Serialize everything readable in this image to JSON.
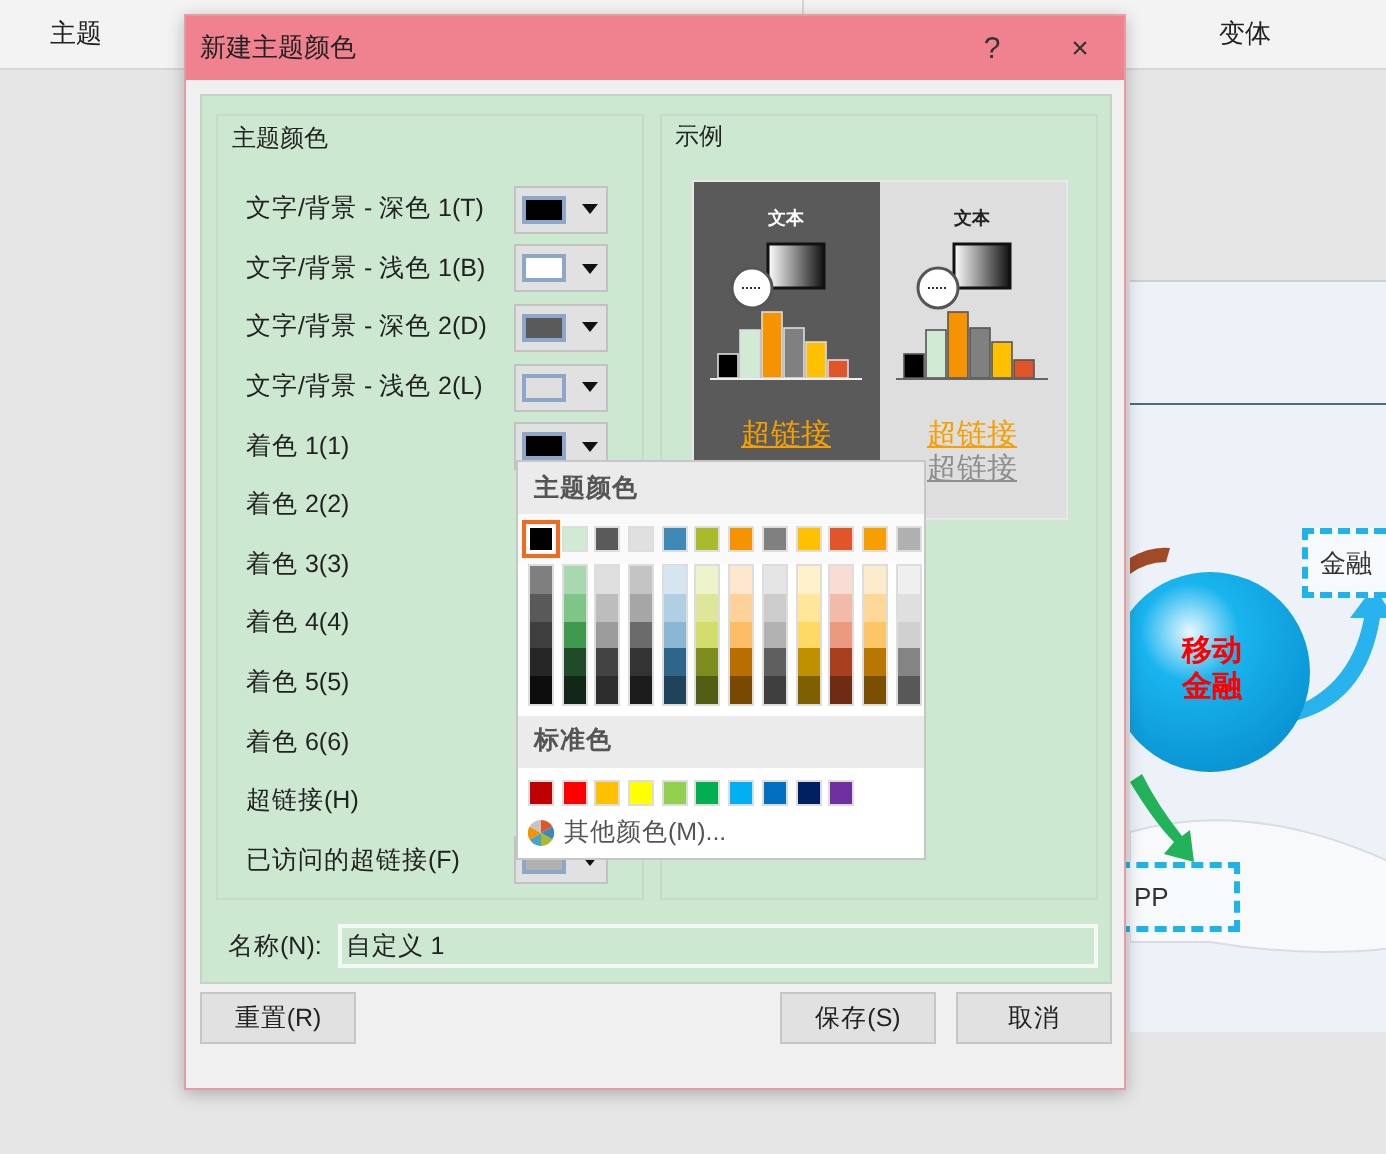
{
  "app": {
    "left_header": "主题",
    "right_header": "变体"
  },
  "slide": {
    "center_lines": [
      "移动",
      "金融"
    ],
    "box_top": "金融",
    "box_bottom": "PP"
  },
  "dialog": {
    "title": "新建主题颜色",
    "help": "?",
    "close": "×"
  },
  "theme_colors": {
    "heading": "主题颜色",
    "rows": [
      {
        "label": "文字/背景 - 深色 1(T)",
        "color": "#000000"
      },
      {
        "label": "文字/背景 - 浅色 1(B)",
        "color": "#ffffff"
      },
      {
        "label": "文字/背景 - 深色 2(D)",
        "color": "#5a5a5a"
      },
      {
        "label": "文字/背景 - 浅色 2(L)",
        "color": "#dedede"
      },
      {
        "label": "着色 1(1)",
        "color": "#000000"
      },
      {
        "label": "着色 2(2)"
      },
      {
        "label": "着色 3(3)"
      },
      {
        "label": "着色 4(4)"
      },
      {
        "label": "着色 5(5)"
      },
      {
        "label": "着色 6(6)"
      },
      {
        "label": "超链接(H)"
      },
      {
        "label": "已访问的超链接(F)",
        "color": "#b0b0b0"
      }
    ]
  },
  "sample": {
    "heading": "示例",
    "panels": [
      {
        "kind": "dark",
        "text": "文本",
        "link": "超链接"
      },
      {
        "kind": "light",
        "text": "文本",
        "link": "超链接",
        "visited_link": "超链接"
      }
    ]
  },
  "popup": {
    "theme_heading": "主题颜色",
    "theme_colors": [
      {
        "color": "#000000",
        "selected": true
      },
      {
        "color": "#d0ead4",
        "selected": false
      },
      {
        "color": "#5a5a5a",
        "selected": false
      },
      {
        "color": "#e0e0e0",
        "selected": false
      },
      {
        "color": "#3f89b8",
        "selected": false
      },
      {
        "color": "#a9bb2a",
        "selected": false
      },
      {
        "color": "#f59300",
        "selected": false
      },
      {
        "color": "#808080",
        "selected": false
      },
      {
        "color": "#ffc000",
        "selected": false
      },
      {
        "color": "#e0562a",
        "selected": false
      },
      {
        "color": "#f5a000",
        "selected": false
      },
      {
        "color": "#b0b0b0",
        "selected": false
      }
    ],
    "shade_columns": [
      {
        "colors": [
          {
            "color": "#7f7f7f"
          },
          {
            "color": "#595959"
          },
          {
            "color": "#3f3f3f"
          },
          {
            "color": "#262626"
          },
          {
            "color": "#0d0d0d"
          }
        ]
      },
      {
        "colors": [
          {
            "color": "#a9d8b0"
          },
          {
            "color": "#7fc58a"
          },
          {
            "color": "#3f9a50"
          },
          {
            "color": "#214a28"
          },
          {
            "color": "#122717"
          }
        ]
      },
      {
        "colors": [
          {
            "color": "#dedede"
          },
          {
            "color": "#bdbdbd"
          },
          {
            "color": "#9c9c9c"
          },
          {
            "color": "#434343"
          },
          {
            "color": "#2d2d2d"
          }
        ]
      },
      {
        "colors": [
          {
            "color": "#c4c4c4"
          },
          {
            "color": "#a6a6a6"
          },
          {
            "color": "#6b6b6b"
          },
          {
            "color": "#333333"
          },
          {
            "color": "#1c1c1c"
          }
        ]
      },
      {
        "colors": [
          {
            "color": "#d6e6f0"
          },
          {
            "color": "#b0cfe2"
          },
          {
            "color": "#8ab7d4"
          },
          {
            "color": "#2e6589"
          },
          {
            "color": "#1f435b"
          }
        ]
      },
      {
        "colors": [
          {
            "color": "#eef3cc"
          },
          {
            "color": "#dde699"
          },
          {
            "color": "#d3dd6c"
          },
          {
            "color": "#7e8b1f"
          },
          {
            "color": "#535d14"
          }
        ]
      },
      {
        "colors": [
          {
            "color": "#fde8cc"
          },
          {
            "color": "#fdd299"
          },
          {
            "color": "#fdbd66"
          },
          {
            "color": "#b86e00"
          },
          {
            "color": "#7a4900"
          }
        ]
      },
      {
        "colors": [
          {
            "color": "#e5e5e5"
          },
          {
            "color": "#cccccc"
          },
          {
            "color": "#b2b2b2"
          },
          {
            "color": "#5f5f5f"
          },
          {
            "color": "#3f3f3f"
          }
        ]
      },
      {
        "colors": [
          {
            "color": "#fff1cc"
          },
          {
            "color": "#ffe699"
          },
          {
            "color": "#ffd966"
          },
          {
            "color": "#bf9000"
          },
          {
            "color": "#7f6000"
          }
        ]
      },
      {
        "colors": [
          {
            "color": "#f9ddd4"
          },
          {
            "color": "#f2bba9"
          },
          {
            "color": "#ec9a7f"
          },
          {
            "color": "#a8401f"
          },
          {
            "color": "#702b15"
          }
        ]
      },
      {
        "colors": [
          {
            "color": "#fdeccc"
          },
          {
            "color": "#fdd899"
          },
          {
            "color": "#fdc566"
          },
          {
            "color": "#b87800"
          },
          {
            "color": "#7a5000"
          }
        ]
      },
      {
        "colors": [
          {
            "color": "#efefef"
          },
          {
            "color": "#dfdfdf"
          },
          {
            "color": "#d0d0d0"
          },
          {
            "color": "#848484"
          },
          {
            "color": "#585858"
          }
        ]
      }
    ],
    "standard_heading": "标准色",
    "standard_colors": [
      {
        "color": "#c00000"
      },
      {
        "color": "#ff0000"
      },
      {
        "color": "#ffc000"
      },
      {
        "color": "#ffff00"
      },
      {
        "color": "#92d050"
      },
      {
        "color": "#00b050"
      },
      {
        "color": "#00b0f0"
      },
      {
        "color": "#0070c0"
      },
      {
        "color": "#002060"
      },
      {
        "color": "#7030a0"
      }
    ],
    "more_colors": "其他颜色(M)..."
  },
  "name_field": {
    "label": "名称(N):",
    "value": "自定义 1"
  },
  "buttons": [
    {
      "label": "重置(R)"
    },
    {
      "label": "保存(S)"
    },
    {
      "label": "取消"
    }
  ]
}
